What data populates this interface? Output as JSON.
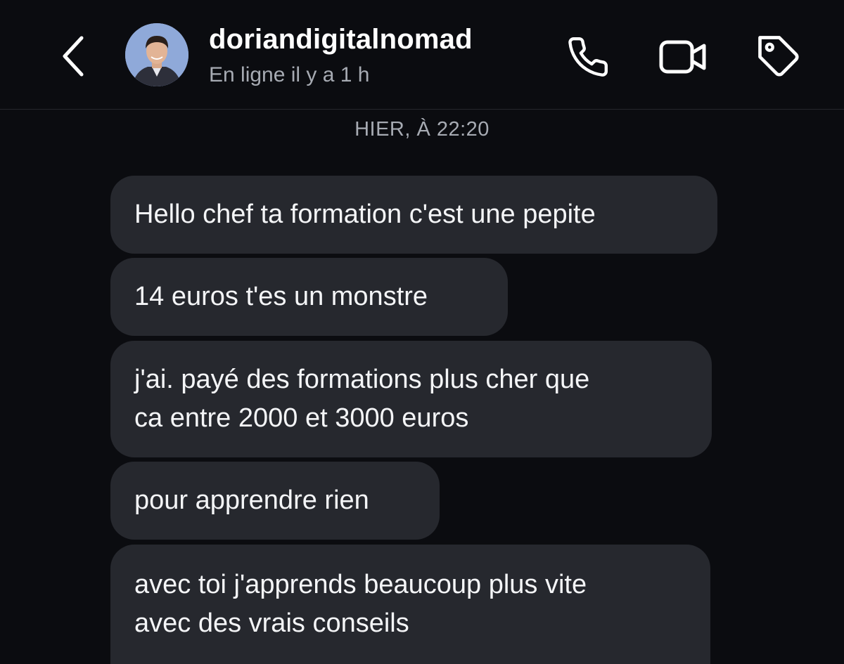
{
  "header": {
    "back_icon": "chevron-left-icon",
    "username": "doriandigitalnomad",
    "status": "En ligne il y a 1 h",
    "avatar": "profile-photo",
    "actions": {
      "call_icon": "phone-icon",
      "video_icon": "video-camera-icon",
      "tag_icon": "tag-icon"
    }
  },
  "conversation": {
    "timestamp": "HIER, À 22:20",
    "messages": [
      {
        "lines": [
          "Hello chef ta formation c'est une pepite"
        ]
      },
      {
        "lines": [
          "14 euros t'es un monstre"
        ]
      },
      {
        "lines": [
          "j'ai. payé des formations plus cher que",
          "ca entre 2000 et 3000 euros"
        ]
      },
      {
        "lines": [
          "pour apprendre rien"
        ]
      },
      {
        "lines": [
          "avec toi j'apprends beaucoup plus vite",
          "avec des vrais conseils"
        ]
      }
    ]
  },
  "colors": {
    "background": "#0b0c10",
    "bubble": "#26282e",
    "secondary_text": "#a7abb3",
    "avatar_bg": "#8fa9d9"
  }
}
